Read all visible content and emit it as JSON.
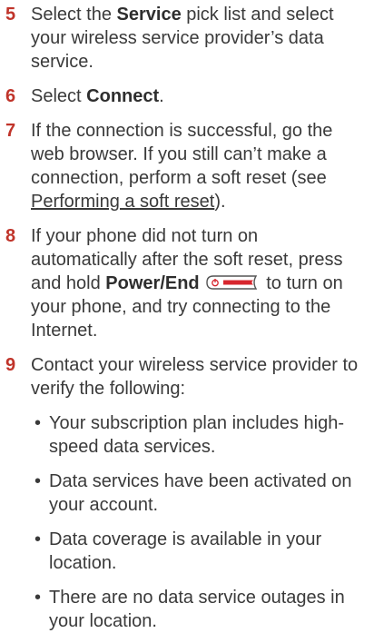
{
  "steps": [
    {
      "number": "5",
      "pre": "Select the ",
      "bold": "Service",
      "post": " pick list and select your wireless service provider’s data service."
    },
    {
      "number": "6",
      "pre": "Select ",
      "bold": "Connect",
      "post": "."
    },
    {
      "number": "7",
      "pre": "If the connection is successful, go the web browser. If you still can’t make a connection, perform a soft reset (see ",
      "link": "Performing a soft reset",
      "post": ")."
    },
    {
      "number": "8",
      "pre": "If your phone did not turn on automatically after the soft reset, press and hold ",
      "bold": "Power/End",
      "icon": "power-end-key-icon",
      "post": " to turn on your phone, and try connecting to the Internet."
    },
    {
      "number": "9",
      "pre": "Contact your wireless service provider to verify the following:",
      "bullets": [
        "Your subscription plan includes high-speed data services.",
        "Data services have been activated on your account.",
        "Data coverage is available in your location.",
        "There are no data service outages in your location."
      ]
    }
  ],
  "colors": {
    "step_number": "#c0342a",
    "power_key": "#d7262e"
  }
}
